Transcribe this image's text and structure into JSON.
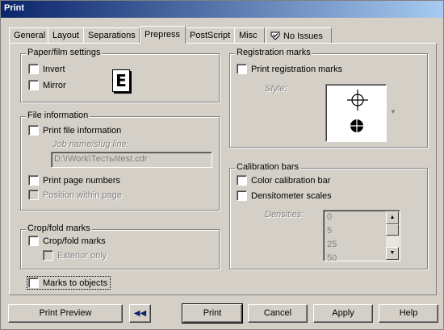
{
  "window": {
    "title": "Print"
  },
  "tabs": [
    {
      "label": "General"
    },
    {
      "label": "Layout"
    },
    {
      "label": "Separations"
    },
    {
      "label": "Prepress",
      "active": true
    },
    {
      "label": "PostScript"
    },
    {
      "label": "Misc"
    },
    {
      "label": "No Issues",
      "icon": "issues-icon"
    }
  ],
  "paper_film": {
    "title": "Paper/film settings",
    "invert": "Invert",
    "mirror": "Mirror",
    "preview_letter": "E"
  },
  "file_info": {
    "title": "File information",
    "print_file_info": "Print file information",
    "job_label": "Job name/slug line:",
    "job_value": "D:\\!Work\\Тесты\\test.cdr",
    "print_page_numbers": "Print page numbers",
    "position_within_page": "Position within page"
  },
  "crop_fold": {
    "title": "Crop/fold marks",
    "crop_marks": "Crop/fold marks",
    "exterior_only": "Exterior only"
  },
  "marks_to_objects": "Marks to objects",
  "registration": {
    "title": "Registration marks",
    "print_reg": "Print registration marks",
    "style_label": "Style:"
  },
  "calibration": {
    "title": "Calibration bars",
    "color_bar": "Color calibration bar",
    "densitometer": "Densitometer scales",
    "densities_label": "Densities:",
    "densities": [
      "0",
      "5",
      "25",
      "50"
    ]
  },
  "buttons": {
    "print_preview": "Print Preview",
    "print": "Print",
    "cancel": "Cancel",
    "apply": "Apply",
    "help": "Help"
  }
}
